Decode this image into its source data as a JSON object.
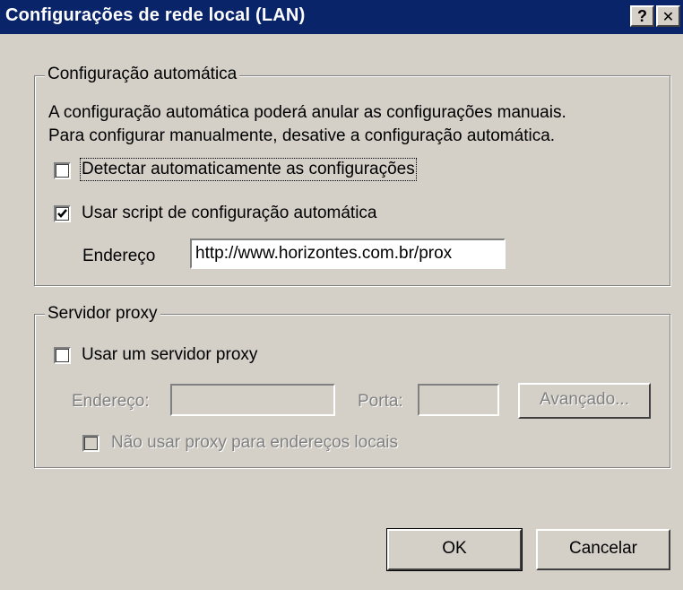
{
  "window": {
    "title": "Configurações de rede local (LAN)",
    "help_button": "?",
    "close_button": "✕"
  },
  "auto_config": {
    "legend": "Configuração automática",
    "description_line1": "A configuração automática poderá anular as configurações manuais.",
    "description_line2": "Para configurar manualmente, desative a configuração automática.",
    "detect": {
      "label": "Detectar automaticamente as configurações",
      "checked": false
    },
    "use_script": {
      "label": "Usar script de configuração automática",
      "checked": true
    },
    "address_label": "Endereço",
    "address_value": "http://www.horizontes.com.br/prox"
  },
  "proxy": {
    "legend": "Servidor proxy",
    "use_proxy": {
      "label": "Usar um servidor proxy",
      "checked": false
    },
    "address_label": "Endereço:",
    "address_value": "",
    "port_label": "Porta:",
    "port_value": "",
    "advanced_button": "Avançado...",
    "bypass_local": {
      "label": "Não usar proxy para endereços locais",
      "checked": false,
      "enabled": false
    }
  },
  "buttons": {
    "ok": "OK",
    "cancel": "Cancelar"
  },
  "colors": {
    "titlebar": "#0a246a",
    "face": "#d4d0c8"
  }
}
